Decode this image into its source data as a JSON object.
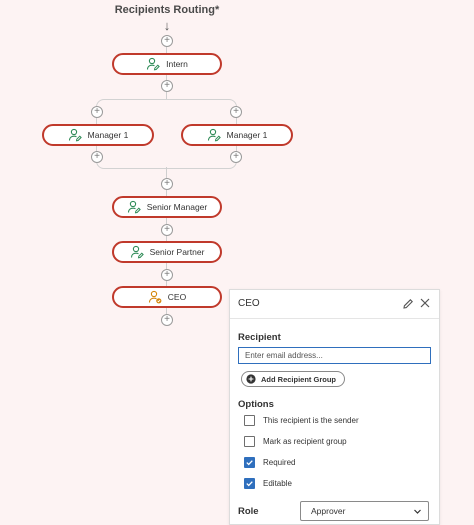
{
  "flow": {
    "title": "Recipients Routing*",
    "arrow_glyph": "↓",
    "plus_glyph": "+",
    "nodes": {
      "intern": "Intern",
      "manager_left": "Manager 1",
      "manager_right": "Manager 1",
      "senior_manager": "Senior Manager",
      "senior_partner": "Senior Partner",
      "ceo": "CEO"
    }
  },
  "panel": {
    "title": "CEO",
    "recipient_label": "Recipient",
    "email_placeholder": "Enter email address...",
    "add_group_label": "Add Recipient Group",
    "options_label": "Options",
    "options": [
      {
        "label": "This recipient is the sender",
        "checked": false
      },
      {
        "label": "Mark as recipient group",
        "checked": false
      },
      {
        "label": "Required",
        "checked": true
      },
      {
        "label": "Editable",
        "checked": true
      }
    ],
    "role_label": "Role",
    "role_value": "Approver"
  },
  "colors": {
    "node_border": "#c0392b",
    "icon_green": "#2e8b57",
    "icon_orange": "#d4860b",
    "checkbox_blue": "#2f6fbd"
  },
  "icons": {
    "recipient": "user-edit-icon",
    "edit": "pencil-icon",
    "close": "close-icon",
    "add_group": "add-circle-icon",
    "dropdown": "chevron-down-icon"
  }
}
